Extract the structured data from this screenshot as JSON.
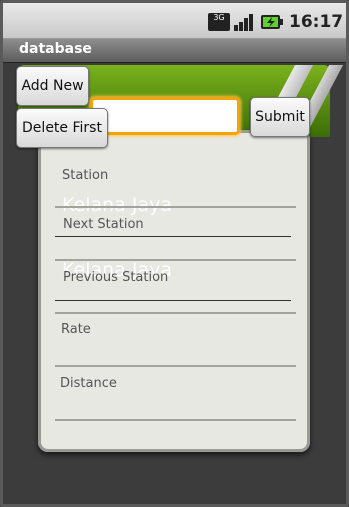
{
  "status_bar": {
    "network_label": "3G",
    "time": "16:17"
  },
  "title_bar": {
    "title": "database"
  },
  "buttons": {
    "add_new": "Add New",
    "delete_first": "Delete First",
    "submit": "Submit"
  },
  "top_input": {
    "value": ""
  },
  "form": {
    "station": {
      "label": "Station",
      "value": "Kelana Jaya"
    },
    "next_station": {
      "label": "Next Station",
      "value": "Kelana Jaya"
    },
    "previous_station": {
      "label": "Previous Station",
      "value": ""
    },
    "rate": {
      "label": "Rate",
      "value": ""
    },
    "distance": {
      "label": "Distance",
      "value": ""
    }
  },
  "colors": {
    "accent_focus": "#f3a30c",
    "header_green": "#5d9a12"
  }
}
